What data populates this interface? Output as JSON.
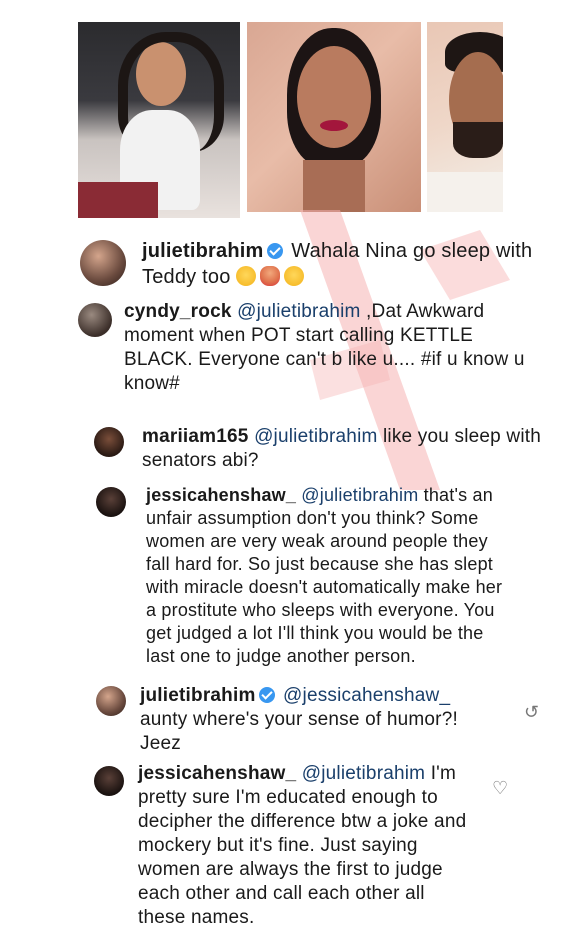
{
  "comments": [
    {
      "username": "julietibrahim",
      "verified": true,
      "text": "Wahala Nina go sleep with Teddy too",
      "emojis": [
        "rolling-eyes-emoji",
        "woman-gesturing-no-emoji",
        "tears-of-joy-emoji"
      ]
    },
    {
      "username": "cyndy_rock",
      "mention": "@julietibrahim",
      "text": " ,Dat Awkward moment when POT start calling KETTLE  BLACK. Everyone can't b like u.... #if u know u know#"
    },
    {
      "username": "mariiam165",
      "mention": "@julietibrahim",
      "text": " like you sleep with senators abi?"
    },
    {
      "username": "jessicahenshaw_",
      "mention": "@julietibrahim",
      "text": " that's an unfair assumption don't you think? Some women are very weak around people they fall hard for. So just because she has slept with miracle doesn't automatically make her a prostitute who sleeps with everyone. You get judged a lot I'll think you would be the last one to judge another person."
    },
    {
      "username": "julietibrahim",
      "verified": true,
      "mention": "@jessicahenshaw_",
      "text": " aunty where's your sense of humor?! Jeez",
      "icon": "reply-arrow-icon"
    },
    {
      "username": "jessicahenshaw_",
      "mention": "@julietibrahim",
      "text": " I'm pretty sure I'm educated enough to decipher the difference btw a joke and mockery but it's fine. Just saying women are always the first to judge each other and call each other all these names.",
      "icon": "heart-icon"
    }
  ]
}
